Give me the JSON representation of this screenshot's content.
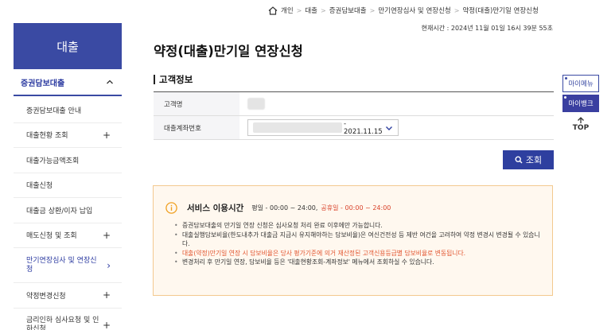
{
  "breadcrumb": {
    "items": [
      "개인",
      "대출",
      "증권담보대출",
      "만기연장심사 및 연장신청",
      "약정(대출)만기일 연장신청"
    ]
  },
  "timestamp": "현재시간 : 2024년 11월 01일 16시 39분 55초",
  "sidebar": {
    "header": "대출",
    "group_label": "증권담보대출",
    "items": [
      {
        "label": "증권담보대출 안내",
        "expand": ""
      },
      {
        "label": "대출현황 조회",
        "expand": "+"
      },
      {
        "label": "대출가능금액조회",
        "expand": ""
      },
      {
        "label": "대출신청",
        "expand": ""
      },
      {
        "label": "대출금 상환/이자 납입",
        "expand": ""
      },
      {
        "label": "매도신청 및 조회",
        "expand": "+"
      },
      {
        "label": "만기연장심사 및 연장신청",
        "expand": "›"
      },
      {
        "label": "약정변경신청",
        "expand": "+"
      },
      {
        "label": "금리인하 심사요청 및 인하신청",
        "expand": "+"
      }
    ]
  },
  "main": {
    "title": "약정(대출)만기일 연장신청",
    "section_title": "고객정보",
    "fields": {
      "customer_name_label": "고객명",
      "account_label": "대출계좌번호",
      "account_date": "- 2021.11.15"
    },
    "search_button": "조회"
  },
  "notice": {
    "title": "서비스 이용시간",
    "weekday": "평일 - 00:00 ~ 24:00,",
    "holiday": "공휴일 - 00:00 ~ 24:00",
    "items": [
      "증권담보대출의 만기일 연장 신청은 심사요청 처리 완료 이후에만 가능합니다.",
      "대출실행담보비율(한도내추가 대출금 지급시 유지해야하는 담보비율)은 여신건전성 등 제반 여건을 고려하여 약정 변경시 변경될 수 있습니다.",
      "대출(약정)만기일 연장 시 담보비율은 당사 평가기준에 의거 재산정된 고객신용등급별 담보비율로 변동됩니다.",
      "변경처리 후 만기일 연장, 담보비율 등은 '대출현황조회-계좌정보' 메뉴에서 조회하실 수 있습니다."
    ]
  },
  "quick": {
    "my_menu": "마이메뉴",
    "my_bank": "마이뱅크",
    "top": "TOP"
  },
  "colors": {
    "brand": "#3a4aa3",
    "button": "#2e3f9f",
    "notice_bg": "#fff8ef",
    "notice_border": "#f3c98f",
    "warning_red": "#e2552f"
  }
}
